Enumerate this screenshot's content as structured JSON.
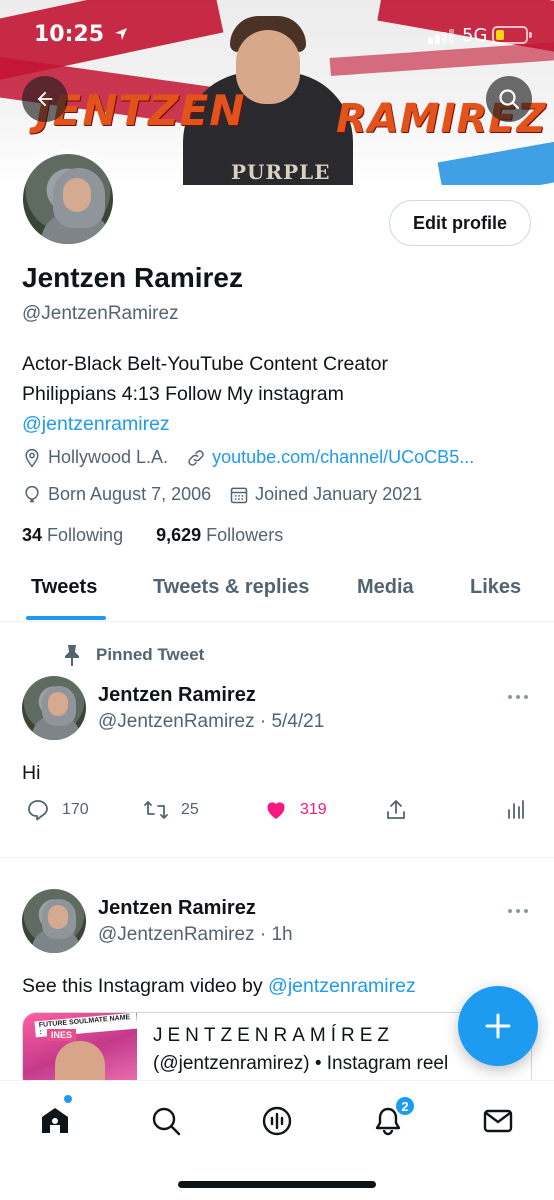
{
  "status_bar": {
    "time": "10:25",
    "network": "5G",
    "battery_level": 0.3,
    "battery_color": "#ffd60a"
  },
  "banner": {
    "word_left": "JENTZEN",
    "word_right": "RAMIREZ",
    "shirt_print": "PURPLE"
  },
  "profile": {
    "edit_label": "Edit profile",
    "name": "Jentzen Ramirez",
    "handle": "@JentzenRamirez",
    "bio_line1": "Actor-Black Belt-YouTube Content Creator",
    "bio_line2": "Philippians 4:13 Follow My instagram",
    "bio_link": "@jentzenramirez",
    "location": "Hollywood L.A.",
    "website": "youtube.com/channel/UCoCB5...",
    "born": "Born August 7, 2006",
    "joined": "Joined January 2021",
    "following_count": "34",
    "following_label": "Following",
    "followers_count": "9,629",
    "followers_label": "Followers"
  },
  "tabs": [
    {
      "label": "Tweets",
      "active": true
    },
    {
      "label": "Tweets & replies",
      "active": false
    },
    {
      "label": "Media",
      "active": false
    },
    {
      "label": "Likes",
      "active": false
    }
  ],
  "tweets": [
    {
      "pinned_label": "Pinned Tweet",
      "name": "Jentzen Ramirez",
      "handle_time": "@JentzenRamirez · 5/4/21",
      "text": "Hi",
      "replies": "170",
      "retweets": "25",
      "likes": "319"
    },
    {
      "name": "Jentzen Ramirez",
      "handle_time": "@JentzenRamirez · 1h",
      "text_prefix": "See this Instagram video by ",
      "text_link": "@jentzenramirez",
      "card": {
        "thumb_tag": "FUTURE SOULMATE NAME :",
        "thumb_tag2": "INES",
        "title": "JENTZENRAMÍREZ",
        "subtitle": "(@jentzenramirez) • Instagram reel"
      }
    }
  ],
  "notifications_badge": "2",
  "colors": {
    "accent": "#1d9bf0",
    "like": "#f91880",
    "text": "#0f1419",
    "muted": "#536471"
  }
}
